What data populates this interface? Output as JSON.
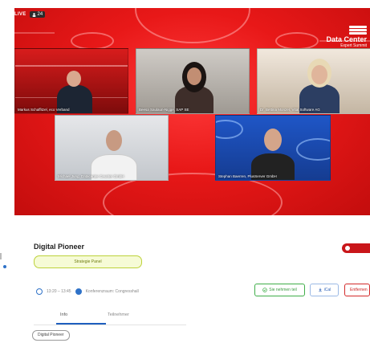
{
  "stream": {
    "live_label": "LIVE",
    "viewer_count": "24",
    "brand": {
      "line1": "Data Center",
      "line2": "Expert Summit"
    }
  },
  "participants": [
    {
      "caption": "Markus Schaffitzel, eco Verband"
    },
    {
      "caption": "Beesa Saulaun-Nigge, SAP SE"
    },
    {
      "caption": "Dr. Bettina Monzer, Vital Software AG"
    },
    {
      "caption": "Michael Jung, Datacenter Ceunter GmbH"
    },
    {
      "caption": "Stephan Baerren, PlusServer GmbH"
    }
  ],
  "session": {
    "title": "Digital Pioneer",
    "tag": "Strategie Panel",
    "time": "13:20 – 13:45",
    "room": "Konferenzraum: Congresshall"
  },
  "actions": {
    "join": "Sie nehmen teil",
    "calendar": "iCal",
    "remove": "Entfernen"
  },
  "tabs": [
    "Info",
    "Teilnehmer"
  ],
  "chips": [
    "Digital Pioneer"
  ],
  "colors": {
    "brand_red": "#e81818",
    "accent_blue": "#1f5fbf",
    "tag_green": "#bdd23a"
  }
}
